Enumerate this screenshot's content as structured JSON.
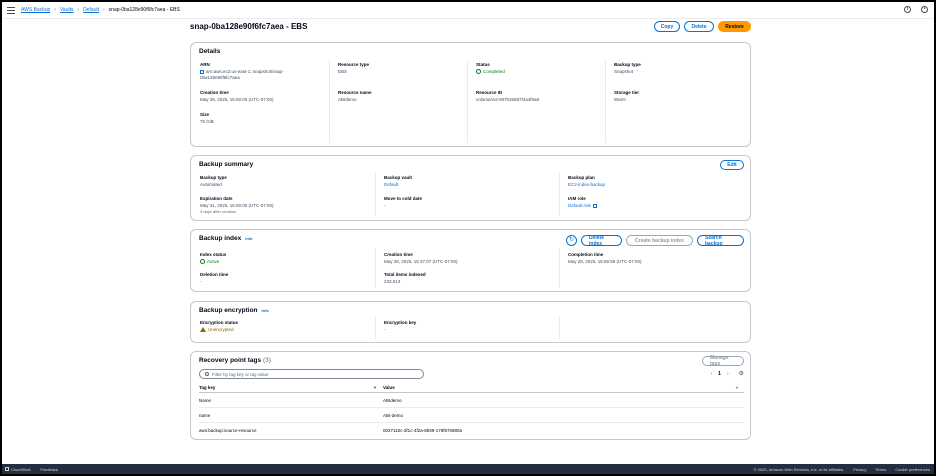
{
  "breadcrumbs": [
    {
      "label": "AWS Backup",
      "link": true
    },
    {
      "label": "Vaults",
      "link": true
    },
    {
      "label": "Default",
      "link": true
    },
    {
      "label": "snap-0ba128e90f6fc7aea - EBS",
      "link": false
    }
  ],
  "header": {
    "title": "snap-0ba128e90f6fc7aea - EBS",
    "copy_label": "Copy",
    "delete_label": "Delete",
    "restore_label": "Restore"
  },
  "details": {
    "title": "Details",
    "arn_label": "ARN",
    "arn_value_line1": "arn:aws:ec2:us-east-1::snapshot/snap-",
    "arn_value_line2": "0ba128e90f6fc7aea",
    "resource_type_label": "Resource type",
    "resource_type_value": "EBS",
    "status_label": "Status",
    "status_value": "Completed",
    "backup_type_label": "Backup type",
    "backup_type_value": "Snapshot",
    "creation_time_label": "Creation time",
    "creation_time_value": "May 28, 2025, 15:00:00 (UTC-07:00)",
    "resource_name_label": "Resource name",
    "resource_name_value": "ABIdemo",
    "resource_id_label": "Resource ID",
    "resource_id_value": "volume/vol-087b35887f4a4f9a8",
    "storage_tier_label": "Storage tier",
    "storage_tier_value": "Warm",
    "size_label": "Size",
    "size_value": "75 GiB"
  },
  "summary": {
    "title": "Backup summary",
    "edit_label": "Edit",
    "backup_type_label": "Backup type",
    "backup_type_value": "Automated",
    "vault_label": "Backup vault",
    "vault_value": "Default",
    "plan_label": "Backup plan",
    "plan_value": "EC2-index-backup",
    "expiration_label": "Expiration date",
    "expiration_value": "May 31, 2025, 15:00:00 (UTC-07:00)",
    "expiration_sub": "3 days after creation",
    "cold_label": "Move to cold date",
    "cold_value": "-",
    "iam_label": "IAM role",
    "iam_value": "Default role"
  },
  "index": {
    "title": "Backup index",
    "info": "Info",
    "delete_label": "Delete index",
    "create_label": "Create backup index",
    "search_label": "Search backup",
    "status_label": "Index status",
    "status_value": "Active",
    "creation_label": "Creation time",
    "creation_value": "May 28, 2025, 15:37:07 (UTC-07:00)",
    "completion_label": "Completion time",
    "completion_value": "May 28, 2025, 15:56:59 (UTC-07:00)",
    "deletion_label": "Deletion time",
    "deletion_value": "-",
    "items_label": "Total items indexed",
    "items_value": "233,613"
  },
  "encryption": {
    "title": "Backup encryption",
    "info": "Info",
    "status_label": "Encryption status",
    "status_value": "Unencrypted",
    "key_label": "Encryption key",
    "key_value": "-"
  },
  "tags": {
    "title": "Recovery point tags",
    "count": "(3)",
    "manage_label": "Manage tags",
    "filter_placeholder": "Filter by tag key or tag value",
    "page": "1",
    "col_key": "Tag key",
    "col_value": "Value",
    "rows": [
      {
        "key": "Name",
        "value": "ABIdemo"
      },
      {
        "key": "name",
        "value": "ABI-demo"
      },
      {
        "key": "aws:backup:source-resource",
        "value": "0027110c-3f1c-4f2a-8b99-178f870880a"
      }
    ]
  },
  "footer": {
    "cloudshell": "CloudShell",
    "feedback": "Feedback",
    "copyright": "© 2025, Amazon Web Services, Inc. or its affiliates.",
    "privacy": "Privacy",
    "terms": "Terms",
    "cookies": "Cookie preferences"
  },
  "icons": [
    "menu-icon",
    "info-icon",
    "settings-icon",
    "copy-icon",
    "status-success-icon",
    "external-link-icon",
    "refresh-icon",
    "warning-icon",
    "search-icon",
    "chevron-left-icon",
    "chevron-right-icon",
    "gear-icon",
    "sort-icon",
    "cloudshell-icon"
  ],
  "colors": {
    "accent": "#0972d3",
    "primary_button": "#ff9900",
    "success": "#037f0c",
    "warning": "#8d6605",
    "footer": "#232f3e"
  }
}
